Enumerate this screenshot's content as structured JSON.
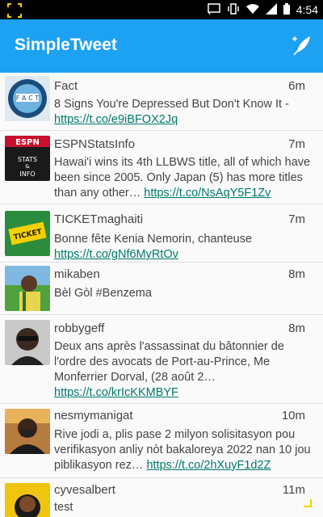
{
  "status": {
    "time": "4:54",
    "icons": [
      "cast-icon",
      "vibrate-icon",
      "wifi-icon",
      "signal-icon",
      "battery-icon"
    ]
  },
  "appbar": {
    "title": "SimpleTweet",
    "compose_icon": "compose-feather-icon"
  },
  "colors": {
    "brand": "#1da1f2",
    "link": "#00796b",
    "text": "#444444"
  },
  "tweets": [
    {
      "name": "Fact",
      "time": "6m",
      "text": "8 Signs You're Depressed But Don't Know It -",
      "link": "https://t.co/e9iBFOX2Jq"
    },
    {
      "name": "ESPNStatsInfo",
      "time": "7m",
      "text": "Hawai'i wins its 4th LLBWS title, all of which have been since 2005. Only Japan (5) has more titles than any other…",
      "link": "https://t.co/NsAqY5F1Zv"
    },
    {
      "name": "TICKETmaghaiti",
      "time": "7m",
      "text": "Bonne fête Kenia Nemorin, chanteuse",
      "link": "https://t.co/gNf6MyRtOv"
    },
    {
      "name": "mikaben",
      "time": "8m",
      "text": "Bèl Gòl #Benzema",
      "link": ""
    },
    {
      "name": "robbygeff",
      "time": "8m",
      "text": "Deux ans après l'assassinat du bâtonnier de l'ordre des avocats de Port-au-Prince, Me Monferrier Dorval, (28 août 2…",
      "link": "https://t.co/krIcKKMBYF"
    },
    {
      "name": "nesmymanigat",
      "time": "10m",
      "text": "Rive jodi a, plis pase 2 milyon solisitasyon pou verifikasyon anliy nòt bakaloreya 2022 nan 10 jou piblikasyon rez…",
      "link": "https://t.co/2hXuyF1d2Z"
    },
    {
      "name": "cyvesalbert",
      "time": "11m",
      "text": "test",
      "link": ""
    }
  ]
}
